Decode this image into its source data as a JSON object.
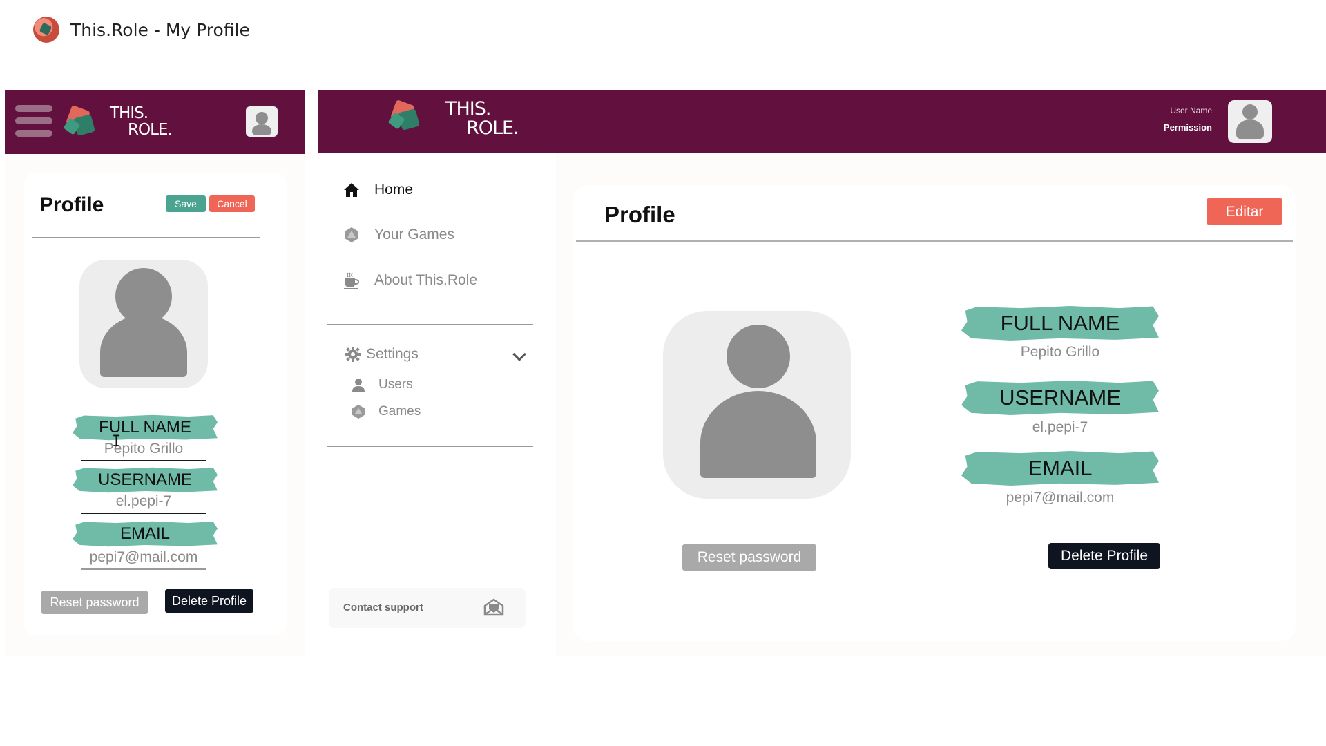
{
  "window": {
    "title": "This.Role - My Profile",
    "icon": "app-logo-icon"
  },
  "brand": {
    "line1": "THIS.",
    "line2": "ROLE."
  },
  "mobile": {
    "header": {
      "menu_icon": "hamburger-menu-icon",
      "avatar_icon": "user-avatar-icon"
    },
    "card": {
      "title": "Profile",
      "save_label": "Save",
      "cancel_label": "Cancel",
      "fields": {
        "full_name": {
          "label": "FULL NAME",
          "value": "Pepito Grillo"
        },
        "username": {
          "label": "USERNAME",
          "value": "el.pepi-7"
        },
        "email": {
          "label": "EMAIL",
          "value": "pepi7@mail.com"
        }
      },
      "reset_label": "Reset password",
      "delete_label": "Delete Profile"
    }
  },
  "desktop": {
    "header": {
      "user_name": "User Name",
      "permission": "Permission"
    },
    "sidebar": {
      "items": [
        {
          "label": "Home",
          "icon": "home-icon",
          "active": true
        },
        {
          "label": "Your Games",
          "icon": "d20-dice-icon",
          "active": false
        },
        {
          "label": "About This.Role",
          "icon": "coffee-cup-icon",
          "active": false
        }
      ],
      "settings": {
        "label": "Settings",
        "icon": "gear-icon",
        "expanded": true
      },
      "sub_items": [
        {
          "label": "Users",
          "icon": "user-icon"
        },
        {
          "label": "Games",
          "icon": "d20-dice-icon"
        }
      ],
      "support": {
        "label": "Contact support",
        "icon": "envelope-icon"
      }
    },
    "card": {
      "title": "Profile",
      "edit_label": "Editar",
      "fields": {
        "full_name": {
          "label": "FULL NAME",
          "value": "Pepito Grillo"
        },
        "username": {
          "label": "USERNAME",
          "value": "el.pepi-7"
        },
        "email": {
          "label": "EMAIL",
          "value": "pepi7@mail.com"
        }
      },
      "reset_label": "Reset password",
      "delete_label": "Delete Profile"
    }
  },
  "colors": {
    "header": "#62113e",
    "accent_teal": "#6fbba8",
    "save_green": "#4aa48f",
    "danger_red": "#ef6657",
    "dark_button": "#0f1520",
    "muted_button": "#a9a9a9"
  }
}
